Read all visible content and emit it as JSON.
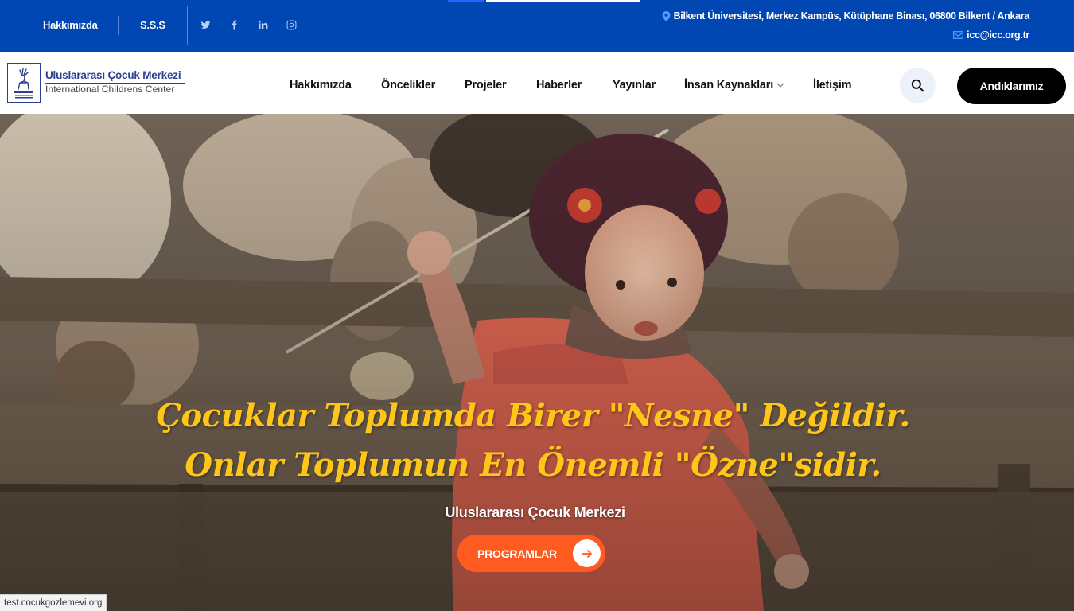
{
  "topbar": {
    "links": [
      "Hakkımızda",
      "S.S.S"
    ],
    "social_icons": [
      "twitter-icon",
      "facebook-icon",
      "linkedin-icon",
      "instagram-icon"
    ],
    "address": "Bilkent Üniversitesi, Merkez Kampüs, Kütüphane Binası, 06800 Bilkent / Ankara",
    "email": "icc@icc.org.tr",
    "background_color": "#0047b3"
  },
  "header": {
    "logo": {
      "title": "Uluslararası Çocuk Merkezi",
      "subtitle": "International Childrens Center"
    },
    "nav": [
      "Hakkımızda",
      "Öncelikler",
      "Projeler",
      "Haberler",
      "Yayınlar",
      "İnsan Kaynakları",
      "İletişim"
    ],
    "dropdown_item": "İnsan Kaynakları",
    "search_icon": "search-icon",
    "cta_label": "Andıklarımız"
  },
  "hero": {
    "headline_line1": "Çocuklar Toplumda Birer \"Nesne\" Değildir.",
    "headline_line2": "Onlar Toplumun En Önemli \"Özne\"sidir.",
    "subtitle": "Uluslararası Çocuk Merkezi",
    "button_label": "PROGRAMLAR",
    "headline_color": "#ffc61a",
    "button_color": "#ff5a1f"
  },
  "status_bar": {
    "url": "test.cocukgozlemevi.org"
  }
}
